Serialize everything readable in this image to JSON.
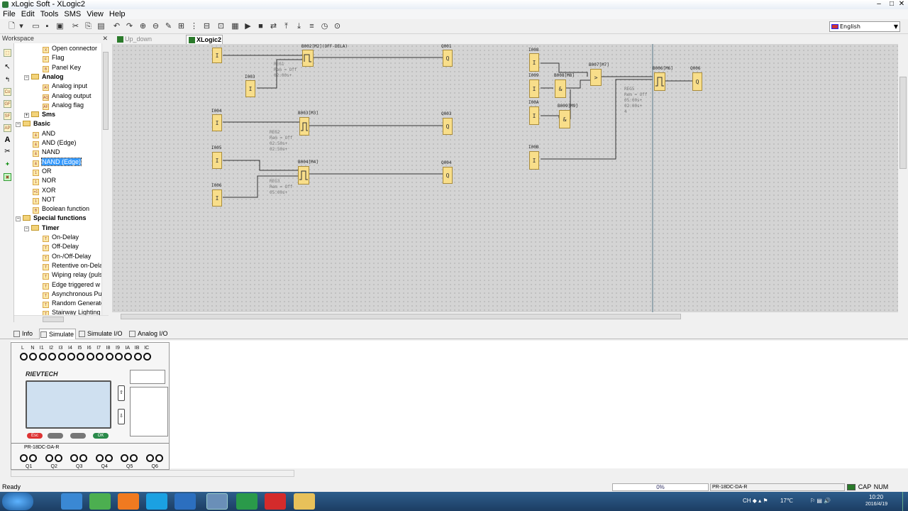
{
  "window": {
    "title": "xLogic Soft - XLogic2"
  },
  "menu": [
    "File",
    "Edit",
    "Tools",
    "SMS",
    "View",
    "Help"
  ],
  "toolbar": {
    "language": "English"
  },
  "workspace": {
    "title": "Workspace",
    "items": [
      {
        "label": "Open connector",
        "type": "leaf",
        "icon": "X"
      },
      {
        "label": "Flag",
        "type": "leaf",
        "icon": "F"
      },
      {
        "label": "Panel Key",
        "type": "leaf",
        "icon": "B"
      },
      {
        "label": "Analog",
        "type": "folder"
      },
      {
        "label": "Analog input",
        "type": "leaf",
        "icon": "AI"
      },
      {
        "label": "Analog output",
        "type": "leaf",
        "icon": "AQ"
      },
      {
        "label": "Analog flag",
        "type": "leaf",
        "icon": "AF"
      },
      {
        "label": "Sms",
        "type": "folder"
      },
      {
        "label": "Basic",
        "type": "folder"
      },
      {
        "label": "AND",
        "type": "leaf",
        "icon": "&"
      },
      {
        "label": "AND (Edge)",
        "type": "leaf",
        "icon": "&"
      },
      {
        "label": "NAND",
        "type": "leaf",
        "icon": "&"
      },
      {
        "label": "NAND (Edge)",
        "type": "leaf",
        "icon": "&",
        "selected": true
      },
      {
        "label": "OR",
        "type": "leaf",
        "icon": "1"
      },
      {
        "label": "NOR",
        "type": "leaf",
        "icon": "1"
      },
      {
        "label": "XOR",
        "type": "leaf",
        "icon": "=1"
      },
      {
        "label": "NOT",
        "type": "leaf",
        "icon": "1"
      },
      {
        "label": "Boolean function",
        "type": "leaf",
        "icon": "B"
      },
      {
        "label": "Special functions",
        "type": "folder"
      },
      {
        "label": "Timer",
        "type": "folder"
      },
      {
        "label": "On-Delay",
        "type": "leaf",
        "icon": "T"
      },
      {
        "label": "Off-Delay",
        "type": "leaf",
        "icon": "T"
      },
      {
        "label": "On-/Off-Delay",
        "type": "leaf",
        "icon": "T"
      },
      {
        "label": "Retentive on-Dela",
        "type": "leaf",
        "icon": "T"
      },
      {
        "label": "Wiping relay (puls",
        "type": "leaf",
        "icon": "T"
      },
      {
        "label": "Edge triggered w",
        "type": "leaf",
        "icon": "T"
      },
      {
        "label": "Asynchronous Pul",
        "type": "leaf",
        "icon": "T"
      },
      {
        "label": "Random Generato",
        "type": "leaf",
        "icon": "T"
      },
      {
        "label": "Stairway Lighting",
        "type": "leaf",
        "icon": "T"
      }
    ]
  },
  "tabs": [
    {
      "label": "Up_down counter.xlg",
      "active": false
    },
    {
      "label": "XLogic2",
      "active": true
    }
  ],
  "diagram": {
    "blocks": [
      {
        "label": "",
        "text": "I"
      },
      {
        "label": "I003",
        "text": "I"
      },
      {
        "label": "I004",
        "text": "I"
      },
      {
        "label": "I005",
        "text": "I"
      },
      {
        "label": "I006",
        "text": "I"
      },
      {
        "label": "B002[M2](OFF-DELA)",
        "text": ""
      },
      {
        "label": "B003[M3]",
        "text": ""
      },
      {
        "label": "B004[M4]",
        "text": ""
      },
      {
        "label": "Q001",
        "text": "Q"
      },
      {
        "label": "Q003",
        "text": "Q"
      },
      {
        "label": "Q004",
        "text": "Q"
      },
      {
        "label": "I008",
        "text": "I"
      },
      {
        "label": "I009",
        "text": "I"
      },
      {
        "label": "I00A",
        "text": "I"
      },
      {
        "label": "I00B",
        "text": "I"
      },
      {
        "label": "B008[M8]",
        "text": "&"
      },
      {
        "label": "B009[M9]",
        "text": "&"
      },
      {
        "label": "B007[M7]",
        "text": ">"
      },
      {
        "label": "B006[M6]",
        "text": ""
      },
      {
        "label": "Q006",
        "text": "Q"
      }
    ],
    "params": [
      "REG1\nRem = Off\n02:00s+",
      "REG2\nRem = Off\n02:50s+\n02:50s+",
      "REG3\nRem = Off\n05:00s+",
      "REG5\nRem = Off\n05:00s+\n02:00s+\n4"
    ]
  },
  "bottom_tabs": [
    "Info",
    "Simulate",
    "Simulate I/O",
    "Analog I/O"
  ],
  "plc": {
    "top_terminals": [
      "L",
      "N",
      "I1",
      "I2",
      "I3",
      "I4",
      "I5",
      "I6",
      "I7",
      "I8",
      "I9",
      "IA",
      "IB",
      "IC"
    ],
    "brand": "RIEVTECH",
    "model": "PR-18DC-DA-R",
    "buttons": [
      "Esc",
      "",
      "",
      "OK"
    ],
    "outputs": [
      "Q1",
      "Q2",
      "Q3",
      "Q4",
      "Q5",
      "Q6"
    ]
  },
  "status": {
    "text": "Ready",
    "progress": "0%",
    "model": "PR-18DC-DA-R",
    "caps": "CAP",
    "num": "NUM"
  },
  "taskbar": {
    "temperature": "17℃",
    "time": "10:20",
    "date": "2016/4/19"
  }
}
